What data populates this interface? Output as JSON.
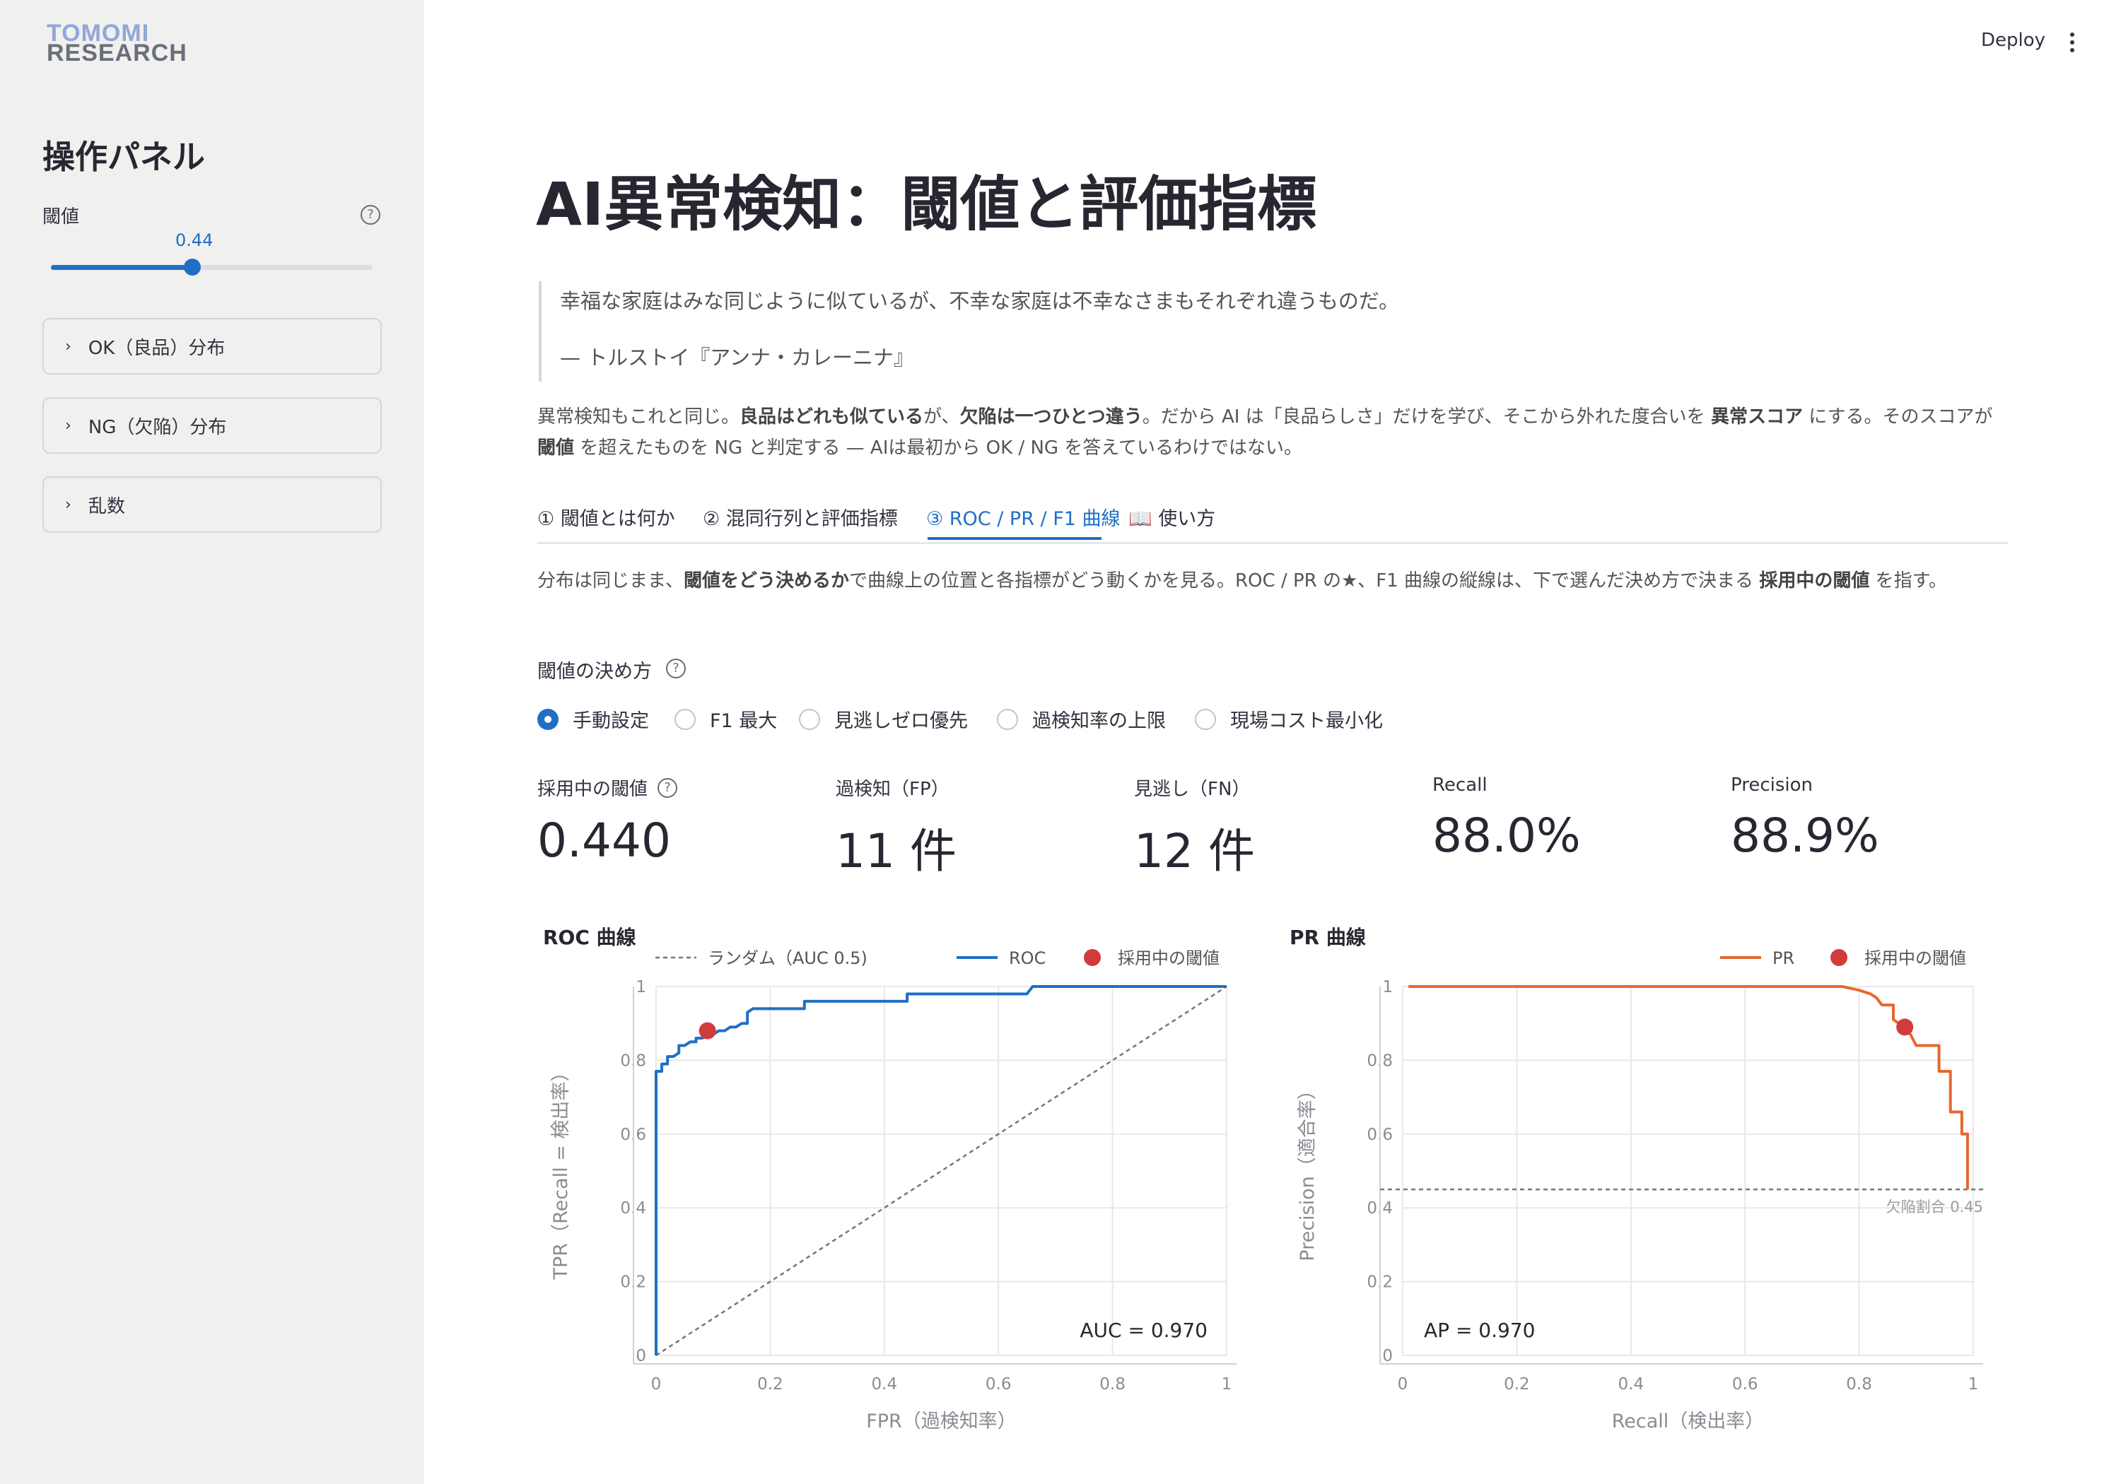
{
  "sidebar": {
    "logo_line1": "TOMOMI",
    "logo_line2": "RESEARCH",
    "title": "操作パネル",
    "threshold_label": "閾値",
    "threshold_value": "0.44",
    "threshold_fraction": 0.44,
    "expanders": [
      {
        "label": "OK（良品）分布"
      },
      {
        "label": "NG（欠陥）分布"
      },
      {
        "label": "乱数"
      }
    ]
  },
  "topbar": {
    "deploy": "Deploy"
  },
  "main": {
    "title": "AI異常検知：閾値と評価指標",
    "quote_text": "幸福な家庭はみな同じように似ているが、不幸な家庭は不幸なさまもそれぞれ違うものだ。",
    "quote_source": "— トルストイ『アンナ・カレーニナ』",
    "para": {
      "t1": "異常検知もこれと同じ。",
      "b1": "良品はどれも似ている",
      "t2": "が、",
      "b2": "欠陥は一つひとつ違う",
      "t3": "。だから AI は「良品らしさ」だけを学び、そこから外れた度合いを ",
      "b3": "異常スコア",
      "t4": " にする。そのスコアが ",
      "b4": "閾値",
      "t5": " を超えたものを NG と判定する — AIは最初から OK / NG を答えているわけではない。"
    },
    "tabs": [
      {
        "label": "① 閾値とは何か"
      },
      {
        "label": "② 混同行列と評価指標"
      },
      {
        "label": "③ ROC / PR / F1 曲線"
      },
      {
        "label": "📖 使い方"
      }
    ],
    "active_tab": 2,
    "para2": {
      "t1": "分布は同じまま、",
      "b1": "閾値をどう決めるか",
      "t2": "で曲線上の位置と各指標がどう動くかを見る。ROC / PR の★、F1 曲線の縦線は、下で選んだ決め方で決まる ",
      "b2": "採用中の閾値",
      "t3": " を指す。"
    },
    "method_label": "閾値の決め方",
    "methods": [
      {
        "label": "手動設定",
        "selected": true
      },
      {
        "label": "F1 最大",
        "selected": false
      },
      {
        "label": "見逃しゼロ優先",
        "selected": false
      },
      {
        "label": "過検知率の上限",
        "selected": false
      },
      {
        "label": "現場コスト最小化",
        "selected": false
      }
    ],
    "metrics": [
      {
        "label": "採用中の閾値",
        "value": "0.440",
        "help": true
      },
      {
        "label": "過検知（FP）",
        "value": "11 件"
      },
      {
        "label": "見逃し（FN）",
        "value": "12 件"
      },
      {
        "label": "Recall",
        "value": "88.0%"
      },
      {
        "label": "Precision",
        "value": "88.9%"
      }
    ]
  },
  "chart_data": [
    {
      "type": "line",
      "title": "ROC 曲線",
      "xlabel": "FPR（過検知率）",
      "ylabel": "TPR（Recall = 検出率）",
      "xlim": [
        0,
        1
      ],
      "ylim": [
        0,
        1
      ],
      "xticks": [
        "0",
        "0.2",
        "0.4",
        "0.6",
        "0.8",
        "1"
      ],
      "yticks": [
        "0",
        "0.2",
        "0.4",
        "0.6",
        "0.8",
        "1"
      ],
      "grid": true,
      "legend": "top-right",
      "annotation": "AUC = 0.970",
      "series": [
        {
          "name": "ランダム（AUC 0.5)",
          "color": "#777777",
          "dash": true,
          "x": [
            0,
            1
          ],
          "y": [
            0,
            1
          ]
        },
        {
          "name": "ROC",
          "color": "#1f6fc5",
          "x": [
            0,
            0,
            0.01,
            0.01,
            0.02,
            0.02,
            0.03,
            0.04,
            0.04,
            0.05,
            0.06,
            0.07,
            0.07,
            0.08,
            0.1,
            0.11,
            0.12,
            0.13,
            0.14,
            0.15,
            0.16,
            0.16,
            0.17,
            0.26,
            0.26,
            0.43,
            0.44,
            0.44,
            0.52,
            0.65,
            0.66,
            1
          ],
          "y": [
            0,
            0.77,
            0.77,
            0.79,
            0.79,
            0.81,
            0.81,
            0.82,
            0.84,
            0.84,
            0.85,
            0.85,
            0.86,
            0.86,
            0.87,
            0.88,
            0.88,
            0.89,
            0.89,
            0.9,
            0.9,
            0.93,
            0.94,
            0.94,
            0.96,
            0.96,
            0.96,
            0.98,
            0.98,
            0.98,
            1,
            1
          ]
        },
        {
          "name": "採用中の閾値",
          "color": "#d13b3b",
          "marker": true,
          "x": [
            0.09
          ],
          "y": [
            0.88
          ]
        }
      ]
    },
    {
      "type": "line",
      "title": "PR 曲線",
      "xlabel": "Recall（検出率）",
      "ylabel": "Precision（適合率）",
      "xlim": [
        0,
        1
      ],
      "ylim": [
        0,
        1
      ],
      "xticks": [
        "0",
        "0.2",
        "0.4",
        "0.6",
        "0.8",
        "1"
      ],
      "yticks": [
        "0",
        "0.2",
        "0.4",
        "0.6",
        "0.8",
        "1"
      ],
      "grid": true,
      "legend": "top-right",
      "annotation": "AP = 0.970",
      "baseline": {
        "value": 0.45,
        "label": "欠陥割合 0.45"
      },
      "series": [
        {
          "name": "PR",
          "color": "#e8672f",
          "x": [
            0.01,
            0.77,
            0.8,
            0.82,
            0.83,
            0.84,
            0.86,
            0.86,
            0.88,
            0.89,
            0.9,
            0.94,
            0.94,
            0.96,
            0.96,
            0.98,
            0.98,
            0.99,
            0.99
          ],
          "y": [
            1,
            1,
            0.99,
            0.98,
            0.97,
            0.95,
            0.95,
            0.91,
            0.89,
            0.87,
            0.84,
            0.84,
            0.77,
            0.77,
            0.66,
            0.66,
            0.6,
            0.6,
            0.45
          ]
        },
        {
          "name": "採用中の閾値",
          "color": "#d13b3b",
          "marker": true,
          "x": [
            0.88
          ],
          "y": [
            0.89
          ]
        }
      ]
    }
  ]
}
